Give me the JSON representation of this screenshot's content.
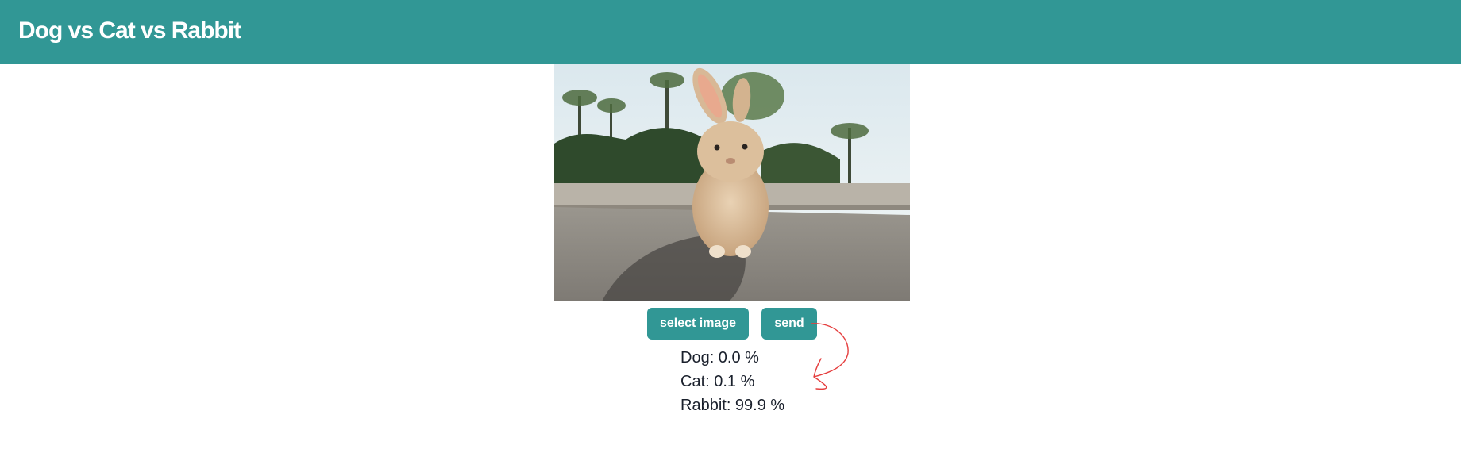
{
  "header": {
    "title": "Dog vs Cat vs Rabbit"
  },
  "buttons": {
    "select_image": "select image",
    "send": "send"
  },
  "results": [
    {
      "label": "Dog",
      "value": "0.0"
    },
    {
      "label": "Cat",
      "value": "0.1"
    },
    {
      "label": "Rabbit",
      "value": "99.9"
    }
  ],
  "results_text": [
    "Dog: 0.0 %",
    "Cat: 0.1 %",
    "Rabbit: 99.9 %"
  ],
  "colors": {
    "accent": "#319795",
    "text": "#1a202c",
    "annotation": "#e53e3e"
  }
}
